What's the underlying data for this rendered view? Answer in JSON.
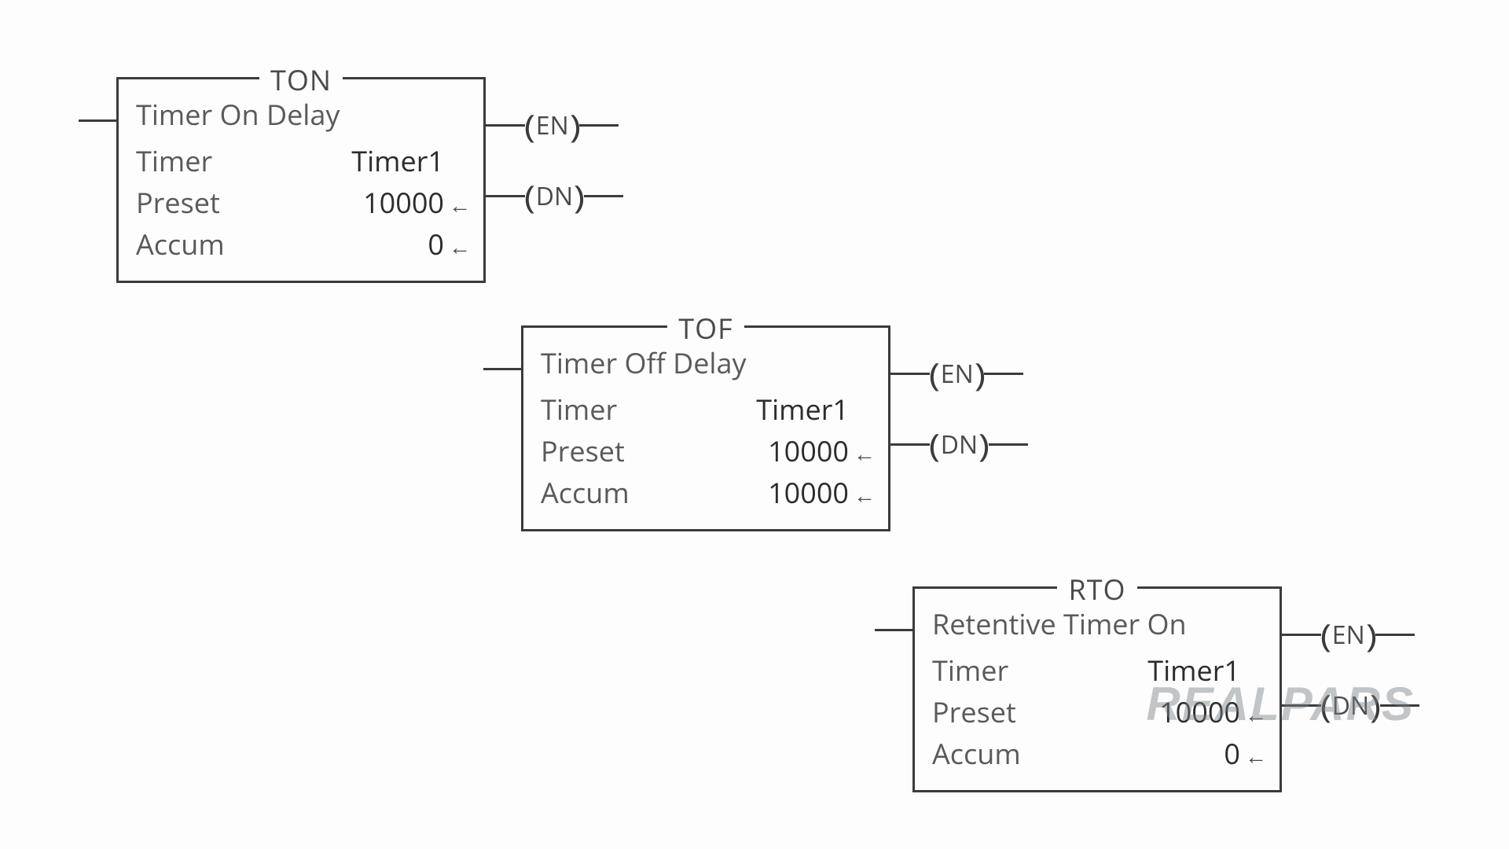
{
  "blocks": [
    {
      "code": "TON",
      "subtitle": "Timer On Delay",
      "timer_label": "Timer",
      "timer_value": "Timer1",
      "preset_label": "Preset",
      "preset_value": "10000",
      "accum_label": "Accum",
      "accum_value": "0",
      "out1": "EN",
      "out2": "DN"
    },
    {
      "code": "TOF",
      "subtitle": "Timer Off Delay",
      "timer_label": "Timer",
      "timer_value": "Timer1",
      "preset_label": "Preset",
      "preset_value": "10000",
      "accum_label": "Accum",
      "accum_value": "10000",
      "out1": "EN",
      "out2": "DN"
    },
    {
      "code": "RTO",
      "subtitle": "Retentive Timer On",
      "timer_label": "Timer",
      "timer_value": "Timer1",
      "preset_label": "Preset",
      "preset_value": "10000",
      "accum_label": "Accum",
      "accum_value": "0",
      "out1": "EN",
      "out2": "DN"
    }
  ],
  "arrow_glyph": "←",
  "watermark": "REALPARS"
}
